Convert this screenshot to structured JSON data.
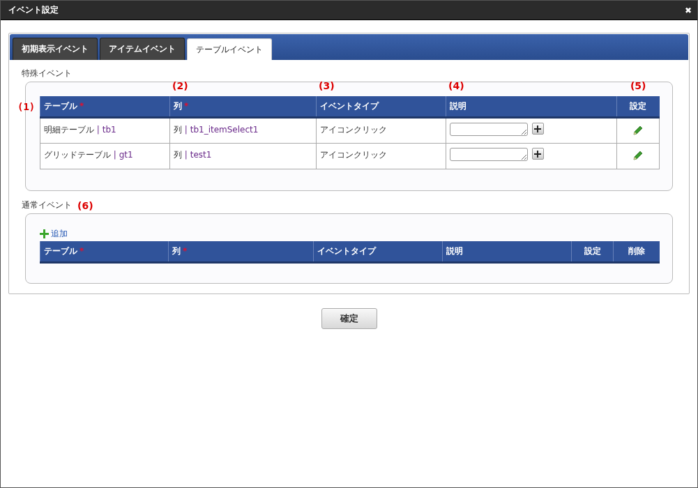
{
  "window": {
    "title": "イベント設定",
    "close": "✖"
  },
  "tabs": [
    {
      "label": "初期表示イベント",
      "selected": false
    },
    {
      "label": "アイテムイベント",
      "selected": false
    },
    {
      "label": "テーブルイベント",
      "selected": true
    }
  ],
  "special": {
    "legend": "特殊イベント",
    "side_callout": "(1)",
    "columns": [
      {
        "label": "テーブル",
        "required": true
      },
      {
        "label": "列",
        "required": true,
        "callout": "(2)"
      },
      {
        "label": "イベントタイプ",
        "required": false,
        "callout": "(3)"
      },
      {
        "label": "説明",
        "required": false,
        "callout": "(4)"
      },
      {
        "label": "設定",
        "required": false,
        "callout": "(5)"
      }
    ],
    "rows": [
      {
        "table": "明細テーブル",
        "table_id": "| tb1",
        "column": "列",
        "column_id": "| tb1_itemSelect1",
        "event_type": "アイコンクリック"
      },
      {
        "table": "グリッドテーブル",
        "table_id": "| gt1",
        "column": "列",
        "column_id": "| test1",
        "event_type": "アイコンクリック"
      }
    ]
  },
  "normal": {
    "legend": "通常イベント",
    "callout": "(6)",
    "add": "追加",
    "columns": [
      {
        "label": "テーブル",
        "required": true
      },
      {
        "label": "列",
        "required": true
      },
      {
        "label": "イベントタイプ",
        "required": false
      },
      {
        "label": "説明",
        "required": false
      },
      {
        "label": "設定",
        "required": false
      },
      {
        "label": "削除",
        "required": false
      }
    ]
  },
  "required_mark": "*",
  "confirm": "確定"
}
